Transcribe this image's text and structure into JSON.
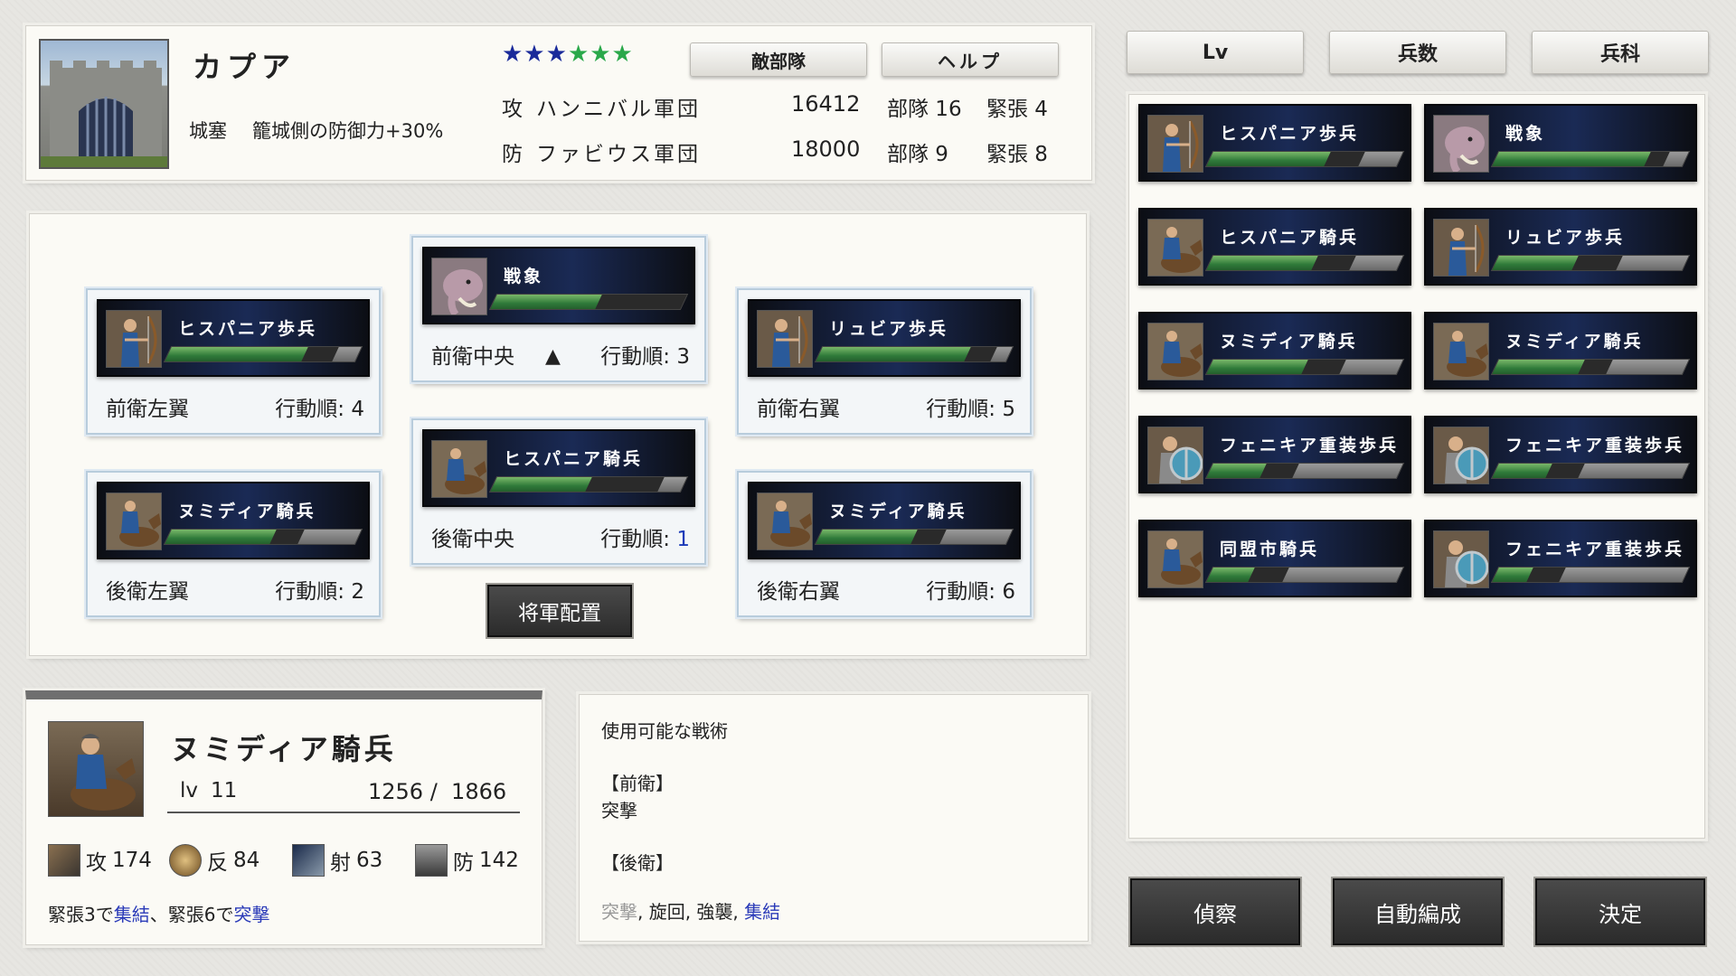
{
  "battle": {
    "castle_name": "カプア",
    "stars": "★★★★★★",
    "enemy_button": "敵部隊",
    "help_button": "ヘルプ",
    "fort_type": "城塞",
    "fort_effect": "籠城側の防御力+30%",
    "attack": {
      "side": "攻",
      "name": "ハンニバル軍団",
      "count": "16412",
      "units": "部隊 16",
      "tension": "緊張 4"
    },
    "defense": {
      "side": "防",
      "name": "ファビウス軍団",
      "count": "18000",
      "units": "部隊 9",
      "tension": "緊張 8"
    }
  },
  "sort_tabs": [
    "Lv",
    "兵数",
    "兵科"
  ],
  "formation": {
    "slots": [
      {
        "unit": "ヒスパニア歩兵",
        "icon": "archer-portrait-icon",
        "position": "前衛左翼",
        "order_label": "行動順:",
        "order": "4",
        "fill": 0.72,
        "rest": 0.12
      },
      {
        "unit": "戦象",
        "icon": "elephant-portrait-icon",
        "position": "前衛中央",
        "marker": "▲",
        "order_label": "行動順:",
        "order": "3",
        "fill": 0.55,
        "rest": 0.0
      },
      {
        "unit": "リュビア歩兵",
        "icon": "archer-portrait-icon",
        "position": "前衛右翼",
        "order_label": "行動順:",
        "order": "5",
        "fill": 0.78,
        "rest": 0.08
      },
      {
        "unit": "ヌミディア騎兵",
        "icon": "cavalry-portrait-icon",
        "position": "後衛左翼",
        "order_label": "行動順:",
        "order": "2",
        "fill": 0.55,
        "rest": 0.3
      },
      {
        "unit": "ヒスパニア騎兵",
        "icon": "cavalry-portrait-icon",
        "position": "後衛中央",
        "order_label": "行動順:",
        "order": "1",
        "fill": 0.5,
        "rest": 0.12
      },
      {
        "unit": "ヌミディア騎兵",
        "icon": "cavalry-portrait-icon",
        "position": "後衛右翼",
        "order_label": "行動順:",
        "order": "6",
        "fill": 0.5,
        "rest": 0.35
      }
    ],
    "general_button": "将軍配置"
  },
  "selected_unit": {
    "name": "ヌミディア騎兵",
    "lv_label": "lv",
    "lv": "11",
    "troops": "1256 /  1866",
    "stats": [
      {
        "icon": "attack-icon",
        "label": "攻",
        "value": "174"
      },
      {
        "icon": "counter-icon",
        "label": "反",
        "value": "84"
      },
      {
        "icon": "ranged-icon",
        "label": "射",
        "value": "63"
      },
      {
        "icon": "defense-icon",
        "label": "防",
        "value": "142"
      }
    ],
    "note_1": "緊張3で",
    "note_skill_1": "集結",
    "note_2": "、緊張6で",
    "note_skill_2": "突撃"
  },
  "tactics": {
    "title": "使用可能な戦術",
    "front_label": "【前衛】",
    "front_list": "突撃",
    "rear_label": "【後衛】",
    "rear_disabled": "突撃",
    "rear_sep": ", 旋回, 強襲, ",
    "rear_enabled": "集結"
  },
  "roster": [
    {
      "unit": "ヒスパニア歩兵",
      "icon": "archer-portrait-icon",
      "fill": 0.62,
      "rest": 0.2
    },
    {
      "unit": "戦象",
      "icon": "elephant-portrait-icon",
      "fill": 0.8,
      "rest": 0.1
    },
    {
      "unit": "ヒスパニア騎兵",
      "icon": "cavalry-portrait-icon",
      "fill": 0.55,
      "rest": 0.25
    },
    {
      "unit": "リュビア歩兵",
      "icon": "archer-portrait-icon",
      "fill": 0.42,
      "rest": 0.35
    },
    {
      "unit": "ヌミディア騎兵",
      "icon": "cavalry-portrait-icon",
      "fill": 0.5,
      "rest": 0.3
    },
    {
      "unit": "ヌミディア騎兵",
      "icon": "cavalry-portrait-icon",
      "fill": 0.45,
      "rest": 0.4
    },
    {
      "unit": "フェニキア重装歩兵",
      "icon": "shield-infantry-portrait-icon",
      "fill": 0.28,
      "rest": 0.55
    },
    {
      "unit": "フェニキア重装歩兵",
      "icon": "shield-infantry-portrait-icon",
      "fill": 0.28,
      "rest": 0.55
    },
    {
      "unit": "同盟市騎兵",
      "icon": "cavalry-portrait-icon",
      "fill": 0.22,
      "rest": 0.6
    },
    {
      "unit": "フェニキア重装歩兵",
      "icon": "shield-infantry-portrait-icon",
      "fill": 0.18,
      "rest": 0.65
    }
  ],
  "actions": [
    "偵察",
    "自動編成",
    "決定"
  ],
  "colors": {
    "accent_blue": "#1a3ab8",
    "bar_green": "#2f7a3a",
    "star_blue": "#1a2a9a",
    "star_green": "#2aa84a"
  }
}
